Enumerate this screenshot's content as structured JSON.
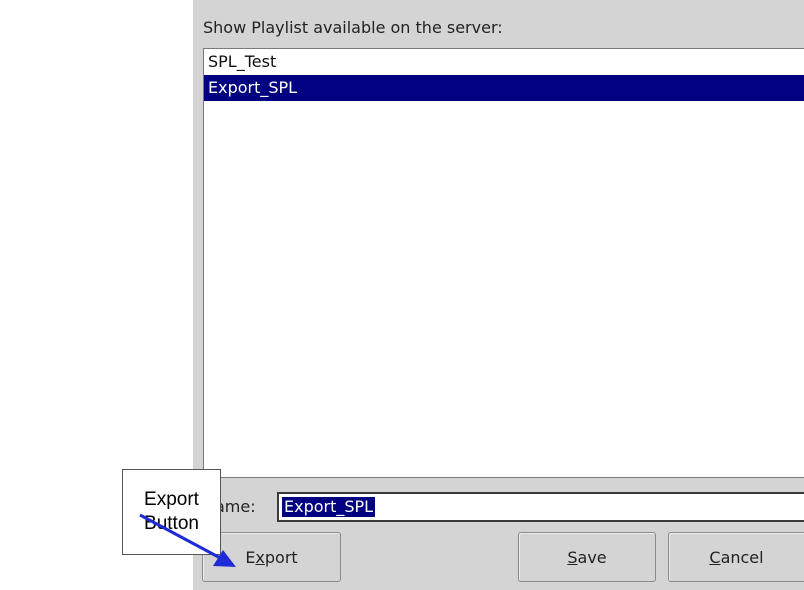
{
  "dialog": {
    "prompt": "Show Playlist available on the server:",
    "playlists": [
      {
        "label": "SPL_Test",
        "selected": false
      },
      {
        "label": "Export_SPL",
        "selected": true
      }
    ],
    "name_label": "Name:",
    "name_value": "Export_SPL"
  },
  "buttons": {
    "export": {
      "before": "E",
      "mnemonic": "x",
      "after": "port"
    },
    "save": {
      "before": "",
      "mnemonic": "S",
      "after": "ave"
    },
    "cancel": {
      "before": "",
      "mnemonic": "C",
      "after": "ancel"
    }
  },
  "annotation": {
    "line1": "Export",
    "line2": "Button",
    "arrow_color": "#1f2bd6"
  },
  "colors": {
    "selection": "#000080",
    "dialog_bg": "#d4d4d4"
  }
}
